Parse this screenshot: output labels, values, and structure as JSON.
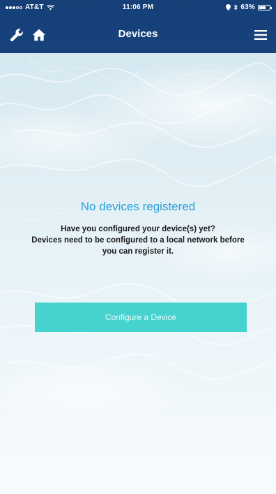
{
  "status_bar": {
    "carrier": "AT&T",
    "time": "11:06 PM",
    "battery": "63%",
    "battery_level": 0.63
  },
  "nav": {
    "title": "Devices",
    "left_icons": [
      "wrench-icon",
      "home-icon"
    ],
    "right_icon": "hamburger-menu-icon"
  },
  "empty_state": {
    "title": "No devices registered",
    "message_lines": [
      "Have you configured your device(s) yet?",
      "Devices need to be configured to a local network before",
      "you can register it."
    ],
    "button_label": "Configure a Device"
  },
  "colors": {
    "header_bg": "#163f78",
    "title_accent": "#2a9fd6",
    "button_bg": "#46d3cf"
  }
}
